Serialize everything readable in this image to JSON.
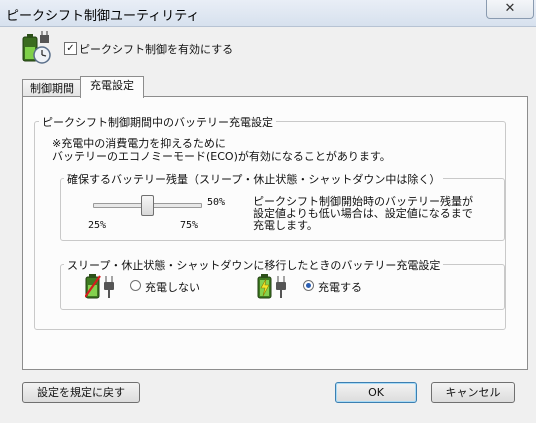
{
  "window": {
    "title": "ピークシフト制御ユーティリティ",
    "close_glyph": "✕"
  },
  "header": {
    "enable_label": "ピークシフト制御を有効にする",
    "enable_checked": true,
    "check_glyph": "✓"
  },
  "tabs": [
    {
      "label": "制御期間",
      "active": false
    },
    {
      "label": "充電設定",
      "active": true
    }
  ],
  "charge_group": {
    "legend": "ピークシフト制御期間中のバッテリー充電設定",
    "note_line1": "※充電中の消費電力を抑えるために",
    "note_line2": "バッテリーのエコノミーモード(ECO)が有効になることがあります。"
  },
  "battery_group": {
    "legend": "確保するバッテリー残量（スリープ・休止状態・シャットダウン中は除く）",
    "slider_value_pct": 50,
    "value_label": "50%",
    "min_label": "25%",
    "max_label": "75%",
    "desc_line1": "ピークシフト制御開始時のバッテリー残量が",
    "desc_line2": "設定値よりも低い場合は、設定値になるまで",
    "desc_line3": "充電します。"
  },
  "sleep_group": {
    "legend": "スリープ・休止状態・シャットダウンに移行したときのバッテリー充電設定",
    "option_no_charge": "充電しない",
    "option_charge": "充電する",
    "selected": "charge"
  },
  "buttons": {
    "reset": "設定を規定に戻す",
    "ok": "OK",
    "cancel": "キャンセル"
  }
}
